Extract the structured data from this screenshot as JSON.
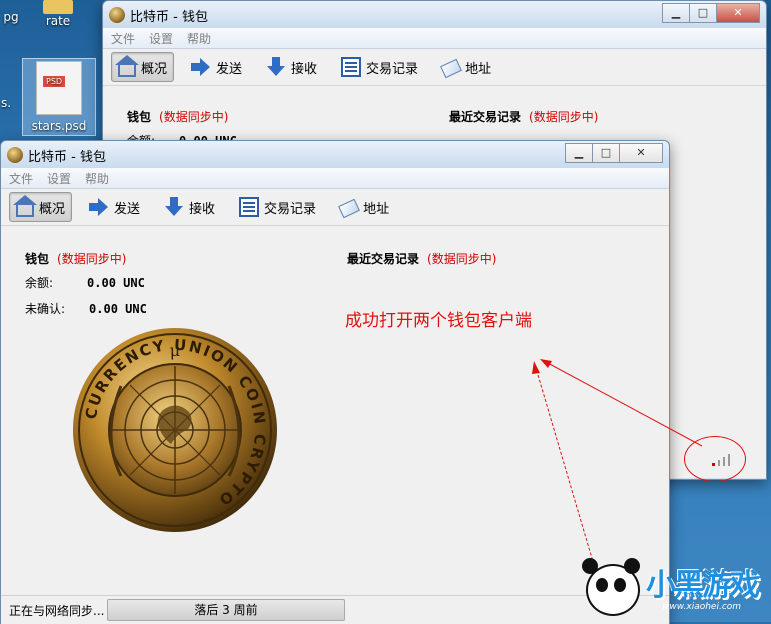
{
  "desktop": {
    "icons": [
      {
        "label": "pg"
      },
      {
        "label": "rate"
      },
      {
        "label": "stars.psd",
        "badge": "PSD"
      },
      {
        "label": "s."
      }
    ]
  },
  "window": {
    "title": "比特币 - 钱包",
    "controls": {
      "minimize": "▁",
      "maximize": "□",
      "close": "✕"
    },
    "menu": [
      "文件",
      "设置",
      "帮助"
    ],
    "toolbar": [
      "概况",
      "发送",
      "接收",
      "交易记录",
      "地址"
    ],
    "wallet_heading": "钱包",
    "sync_status": "(数据同步中)",
    "recent_heading": "最近交易记录",
    "balance_label": "余额:",
    "balance_value": "0.00 UNC",
    "unconfirmed_label": "未确认:",
    "unconfirmed_value": "0.00 UNC",
    "status_left": "正在与网络同步...",
    "status_progress": "落后 3 周前",
    "coin_text": "CURRENCY UNION COIN CRYPTO"
  },
  "annotation": {
    "text": "成功打开两个钱包客户端",
    "color": "#e01010"
  },
  "watermark": {
    "brand": "小黑游戏",
    "site": "www.xiaohei.com"
  }
}
